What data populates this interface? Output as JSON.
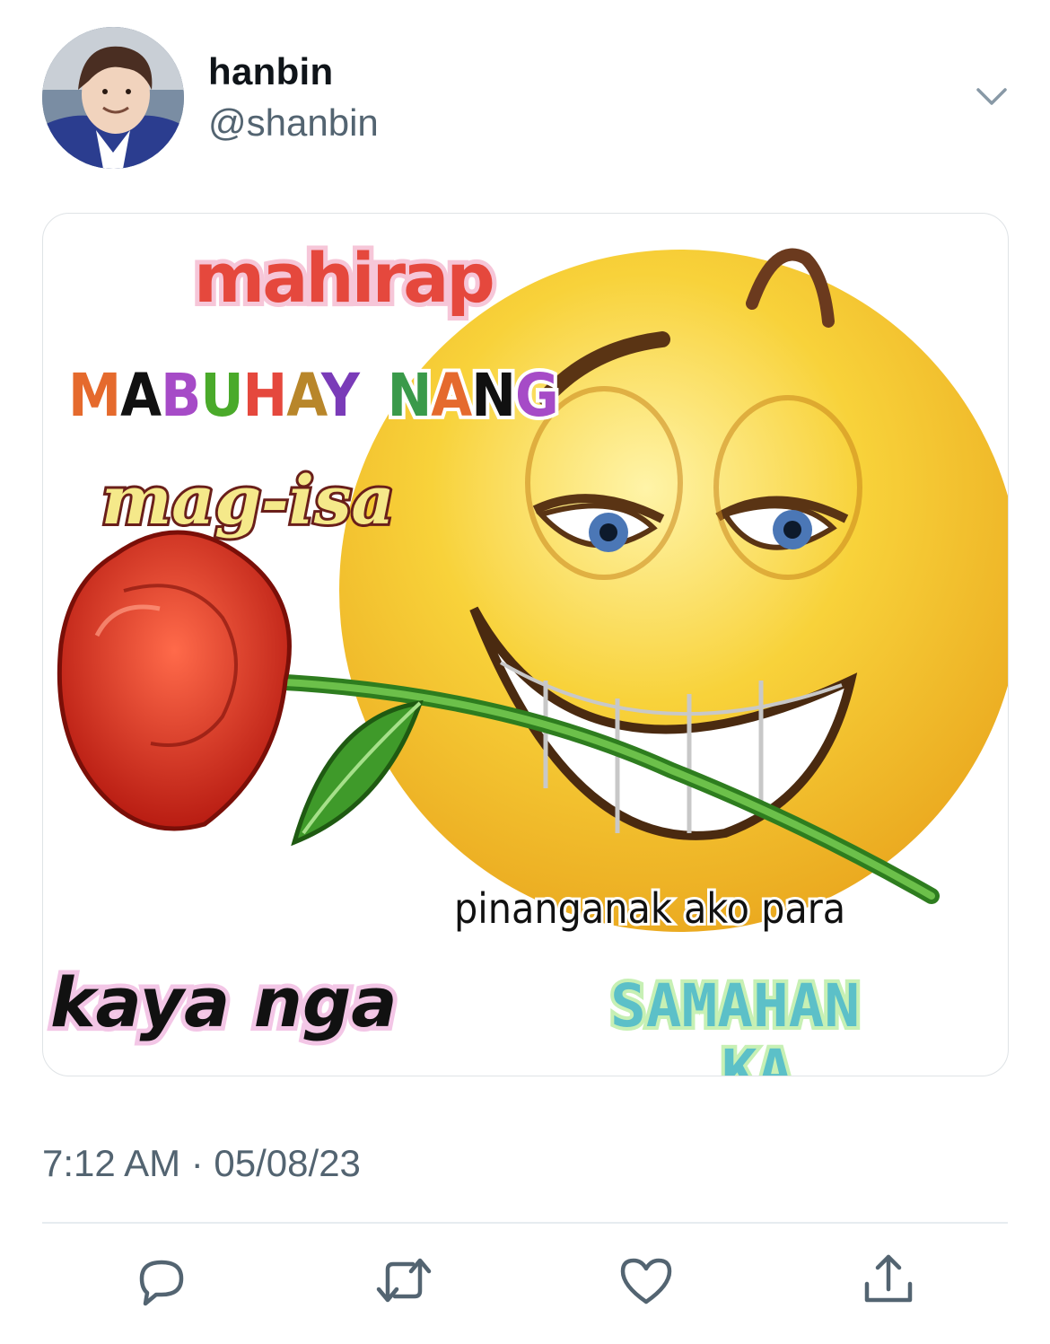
{
  "user": {
    "display_name": "hanbin",
    "handle": "@shanbin",
    "avatar_icon": "profile-photo"
  },
  "meme": {
    "line1": "mahirap",
    "line2_words": [
      "MABUHAY",
      "NANG"
    ],
    "line3": "mag-isa",
    "line4": "pinanganak ako para",
    "line5": "kaya nga",
    "line6": "SAMAHAN",
    "line7": "KA",
    "icons": [
      "smirking-emoji-icon",
      "rose-icon"
    ],
    "colors": {
      "emoji": "#f7c82a",
      "rose": "#d8281c",
      "mahirap": "#e5483d"
    }
  },
  "meta": {
    "timestamp": "7:12 AM · 05/08/23"
  },
  "actions": {
    "icons": [
      "reply-icon",
      "retweet-icon",
      "like-icon",
      "share-icon"
    ]
  }
}
